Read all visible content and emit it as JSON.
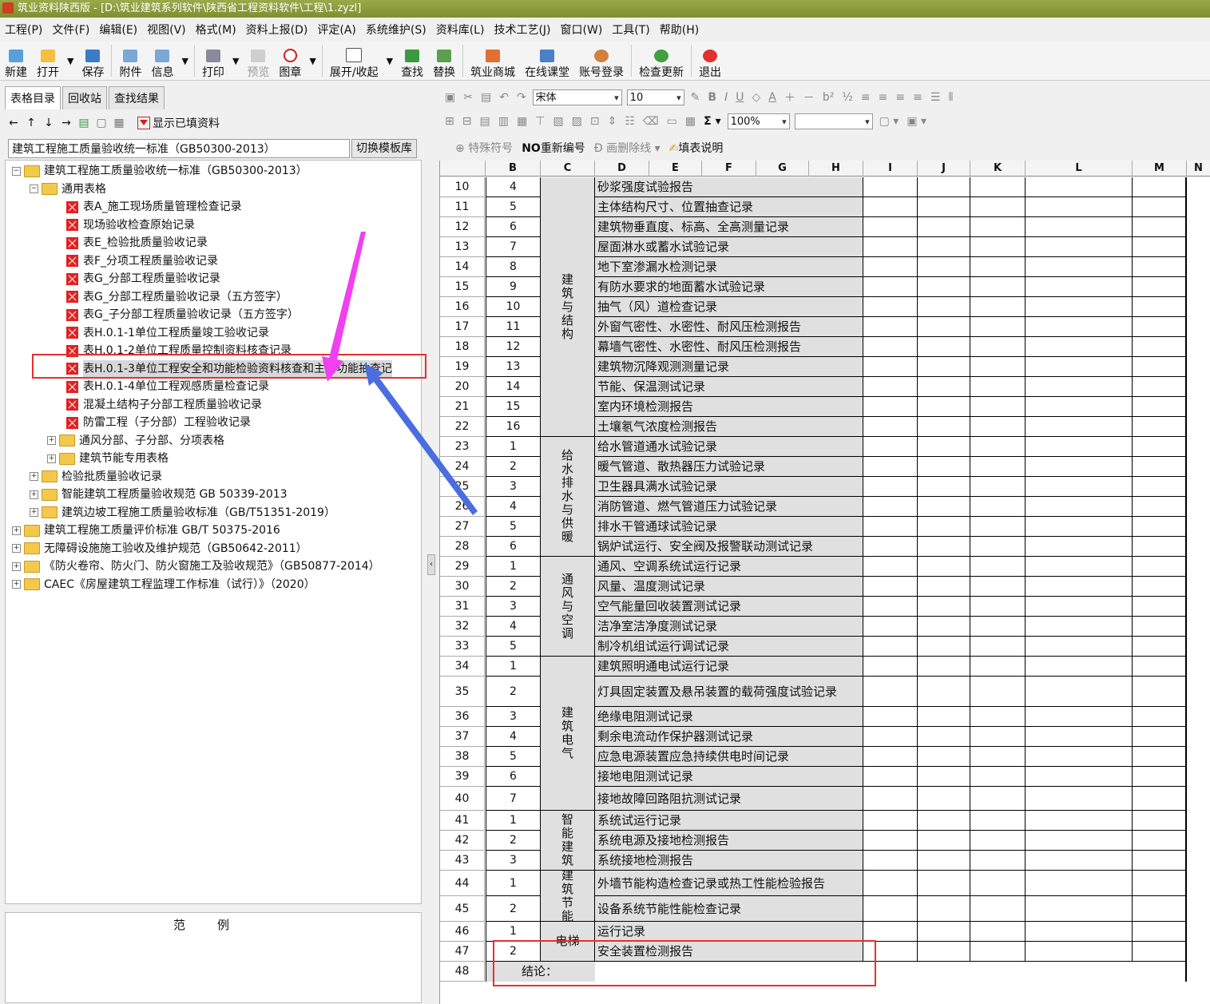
{
  "window": {
    "title": "筑业资料陕西版 - [D:\\筑业建筑系列软件\\陕西省工程资料软件\\工程\\1.zyzl]"
  },
  "menu": [
    "工程(P)",
    "文件(F)",
    "编辑(E)",
    "视图(V)",
    "格式(M)",
    "资料上报(D)",
    "评定(A)",
    "系统维护(S)",
    "资料库(L)",
    "技术工艺(J)",
    "窗口(W)",
    "工具(T)",
    "帮助(H)"
  ],
  "toolbar": {
    "new": "新建",
    "open": "打开",
    "save": "保存",
    "attach": "附件",
    "info": "信息",
    "print": "打印",
    "preview": "预览",
    "stamp": "图章",
    "expand": "展开/收起",
    "find": "查找",
    "replace": "替换",
    "mall": "筑业商城",
    "classroom": "在线课堂",
    "login": "账号登录",
    "update": "检查更新",
    "exit": "退出"
  },
  "left": {
    "tabs": [
      "表格目录",
      "回收站",
      "查找结果"
    ],
    "show_filled": "显示已填资料",
    "standard": "建筑工程施工质量验收统一标准（GB50300-2013）",
    "switch_template": "切换模板库",
    "tree": [
      {
        "level": 0,
        "type": "folder",
        "exp": "−",
        "label": "建筑工程施工质量验收统一标准（GB50300-2013）"
      },
      {
        "level": 1,
        "type": "folder",
        "exp": "−",
        "label": "通用表格"
      },
      {
        "level": 2,
        "type": "doc",
        "label": "表A_施工现场质量管理检查记录"
      },
      {
        "level": 2,
        "type": "doc",
        "label": "现场验收检查原始记录"
      },
      {
        "level": 2,
        "type": "doc",
        "label": "表E_检验批质量验收记录"
      },
      {
        "level": 2,
        "type": "doc",
        "label": "表F_分项工程质量验收记录"
      },
      {
        "level": 2,
        "type": "doc",
        "label": "表G_分部工程质量验收记录"
      },
      {
        "level": 2,
        "type": "doc",
        "label": "表G_分部工程质量验收记录（五方签字）"
      },
      {
        "level": 2,
        "type": "doc",
        "label": "表G_子分部工程质量验收记录（五方签字）"
      },
      {
        "level": 2,
        "type": "doc",
        "label": "表H.0.1-1单位工程质量竣工验收记录"
      },
      {
        "level": 2,
        "type": "doc",
        "label": "表H.0.1-2单位工程质量控制资料核查记录"
      },
      {
        "level": 2,
        "type": "doc",
        "label": "表H.0.1-3单位工程安全和功能检验资料核查和主要功能抽查记",
        "selected": true
      },
      {
        "level": 2,
        "type": "doc",
        "label": "表H.0.1-4单位工程观感质量检查记录"
      },
      {
        "level": 2,
        "type": "doc",
        "label": "混凝土结构子分部工程质量验收记录"
      },
      {
        "level": 2,
        "type": "doc",
        "label": "防雷工程（子分部）工程验收记录"
      },
      {
        "level": 2,
        "type": "folder",
        "exp": "+",
        "label": "通风分部、子分部、分项表格"
      },
      {
        "level": 2,
        "type": "folder",
        "exp": "+",
        "label": "建筑节能专用表格"
      },
      {
        "level": 1,
        "type": "folder",
        "exp": "+",
        "label": "检验批质量验收记录"
      },
      {
        "level": 1,
        "type": "folder",
        "exp": "+",
        "label": "智能建筑工程质量验收规范 GB 50339-2013"
      },
      {
        "level": 1,
        "type": "folder",
        "exp": "+",
        "label": "建筑边坡工程施工质量验收标准（GB/T51351-2019）"
      },
      {
        "level": 0,
        "type": "folder",
        "exp": "+",
        "label": "建筑工程施工质量评价标准 GB/T 50375-2016"
      },
      {
        "level": 0,
        "type": "folder",
        "exp": "+",
        "label": "无障碍设施施工验收及维护规范（GB50642-2011）"
      },
      {
        "level": 0,
        "type": "folder",
        "exp": "+",
        "label": "《防火卷帘、防火门、防火窗施工及验收规范》（GB50877-2014）"
      },
      {
        "level": 0,
        "type": "folder",
        "exp": "+",
        "label": "CAEC《房屋建筑工程监理工作标准（试行）》（2020）"
      }
    ],
    "legend_title": "范例"
  },
  "right_toolbar": {
    "font": "宋体",
    "size": "10",
    "zoom": "100%",
    "special": "特殊符号",
    "renumber": "重新编号",
    "strike": "画删除线",
    "fill_note": "填表说明"
  },
  "sheet": {
    "columns": [
      "B",
      "C",
      "D",
      "E",
      "F",
      "G",
      "H",
      "I",
      "J",
      "K",
      "L",
      "M",
      "N"
    ],
    "rows": [
      {
        "r": "10",
        "b": "4",
        "d": "砂浆强度试验报告"
      },
      {
        "r": "11",
        "b": "5",
        "d": "主体结构尺寸、位置抽查记录"
      },
      {
        "r": "12",
        "b": "6",
        "d": "建筑物垂直度、标高、全高测量记录"
      },
      {
        "r": "13",
        "b": "7",
        "d": "屋面淋水或蓄水试验记录"
      },
      {
        "r": "14",
        "b": "8",
        "d": "地下室渗漏水检测记录"
      },
      {
        "r": "15",
        "b": "9",
        "d": "有防水要求的地面蓄水试验记录"
      },
      {
        "r": "16",
        "b": "10",
        "d": "抽气（风）道检查记录"
      },
      {
        "r": "17",
        "b": "11",
        "d": "外窗气密性、水密性、耐风压检测报告"
      },
      {
        "r": "18",
        "b": "12",
        "d": "幕墙气密性、水密性、耐风压检测报告"
      },
      {
        "r": "19",
        "b": "13",
        "d": "建筑物沉降观测测量记录"
      },
      {
        "r": "20",
        "b": "14",
        "d": "节能、保温测试记录"
      },
      {
        "r": "21",
        "b": "15",
        "d": "室内环境检测报告"
      },
      {
        "r": "22",
        "b": "16",
        "d": "土壤氡气浓度检测报告"
      },
      {
        "r": "23",
        "b": "1",
        "d": "给水管道通水试验记录"
      },
      {
        "r": "24",
        "b": "2",
        "d": "暖气管道、散热器压力试验记录"
      },
      {
        "r": "25",
        "b": "3",
        "d": "卫生器具满水试验记录"
      },
      {
        "r": "26",
        "b": "4",
        "d": "消防管道、燃气管道压力试验记录"
      },
      {
        "r": "27",
        "b": "5",
        "d": "排水干管通球试验记录"
      },
      {
        "r": "28",
        "b": "6",
        "d": "锅炉试运行、安全阀及报警联动测试记录"
      },
      {
        "r": "29",
        "b": "1",
        "d": "通风、空调系统试运行记录"
      },
      {
        "r": "30",
        "b": "2",
        "d": "风量、温度测试记录"
      },
      {
        "r": "31",
        "b": "3",
        "d": "空气能量回收装置测试记录"
      },
      {
        "r": "32",
        "b": "4",
        "d": "洁净室洁净度测试记录"
      },
      {
        "r": "33",
        "b": "5",
        "d": "制冷机组试运行调试记录"
      },
      {
        "r": "34",
        "b": "1",
        "d": "建筑照明通电试运行记录"
      },
      {
        "r": "35",
        "b": "2",
        "d": "灯具固定装置及悬吊装置的载荷强度试验记录"
      },
      {
        "r": "36",
        "b": "3",
        "d": "绝缘电阻测试记录"
      },
      {
        "r": "37",
        "b": "4",
        "d": "剩余电流动作保护器测试记录"
      },
      {
        "r": "38",
        "b": "5",
        "d": "应急电源装置应急持续供电时间记录"
      },
      {
        "r": "39",
        "b": "6",
        "d": "接地电阻测试记录"
      },
      {
        "r": "40",
        "b": "7",
        "d": "接地故障回路阻抗测试记录"
      },
      {
        "r": "41",
        "b": "1",
        "d": "系统试运行记录"
      },
      {
        "r": "42",
        "b": "2",
        "d": "系统电源及接地检测报告"
      },
      {
        "r": "43",
        "b": "3",
        "d": "系统接地检测报告"
      },
      {
        "r": "44",
        "b": "1",
        "d": "外墙节能构造检查记录或热工性能检验报告"
      },
      {
        "r": "45",
        "b": "2",
        "d": "设备系统节能性能检查记录"
      },
      {
        "r": "46",
        "b": "1",
        "d": "运行记录"
      },
      {
        "r": "47",
        "b": "2",
        "d": "安全装置检测报告"
      },
      {
        "r": "48",
        "b": "",
        "d": ""
      }
    ],
    "categories": [
      {
        "label": "建筑与结构"
      },
      {
        "label": "给水排水与供暖"
      },
      {
        "label": "通风与空调"
      },
      {
        "label": "建筑电气"
      },
      {
        "label": "智能建筑"
      },
      {
        "label": "建筑节能"
      },
      {
        "label": "电梯"
      }
    ],
    "conclusion": "结论："
  }
}
